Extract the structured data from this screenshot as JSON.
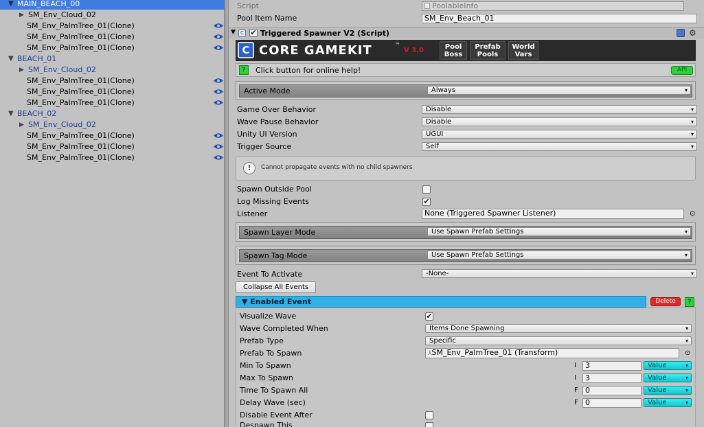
{
  "hierarchy": {
    "rows": [
      {
        "label": "MAIN_BEACH_00",
        "indent": 0,
        "expanded": true,
        "selected": true,
        "style": "normal",
        "eye": false
      },
      {
        "label": "SM_Env_Cloud_02",
        "indent": 1,
        "expanded": false,
        "selected": false,
        "style": "normal",
        "eye": false
      },
      {
        "label": "SM_Env_PalmTree_01(Clone)",
        "indent": 1,
        "expanded": null,
        "selected": false,
        "style": "normal",
        "eye": true
      },
      {
        "label": "SM_Env_PalmTree_01(Clone)",
        "indent": 1,
        "expanded": null,
        "selected": false,
        "style": "normal",
        "eye": true
      },
      {
        "label": "SM_Env_PalmTree_01(Clone)",
        "indent": 1,
        "expanded": null,
        "selected": false,
        "style": "normal",
        "eye": true
      },
      {
        "label": "BEACH_01",
        "indent": 0,
        "expanded": true,
        "selected": false,
        "style": "blue",
        "eye": false
      },
      {
        "label": "SM_Env_Cloud_02",
        "indent": 1,
        "expanded": false,
        "selected": false,
        "style": "blue",
        "eye": false
      },
      {
        "label": "SM_Env_PalmTree_01(Clone)",
        "indent": 1,
        "expanded": null,
        "selected": false,
        "style": "normal",
        "eye": true
      },
      {
        "label": "SM_Env_PalmTree_01(Clone)",
        "indent": 1,
        "expanded": null,
        "selected": false,
        "style": "normal",
        "eye": true
      },
      {
        "label": "SM_Env_PalmTree_01(Clone)",
        "indent": 1,
        "expanded": null,
        "selected": false,
        "style": "normal",
        "eye": true
      },
      {
        "label": "BEACH_02",
        "indent": 0,
        "expanded": true,
        "selected": false,
        "style": "blue",
        "eye": false
      },
      {
        "label": "SM_Env_Cloud_02",
        "indent": 1,
        "expanded": false,
        "selected": false,
        "style": "blue",
        "eye": false
      },
      {
        "label": "SM_Env_PalmTree_01(Clone)",
        "indent": 1,
        "expanded": null,
        "selected": false,
        "style": "normal",
        "eye": true
      },
      {
        "label": "SM_Env_PalmTree_01(Clone)",
        "indent": 1,
        "expanded": null,
        "selected": false,
        "style": "normal",
        "eye": true
      },
      {
        "label": "SM_Env_PalmTree_01(Clone)",
        "indent": 1,
        "expanded": null,
        "selected": false,
        "style": "normal",
        "eye": true
      }
    ]
  },
  "inspector": {
    "script_label": "Script",
    "script_value": "PoolableInfo",
    "pool_item_label": "Pool Item Name",
    "pool_item_value": "SM_Env_Beach_01",
    "component_title": "Triggered Spawner V2 (Script)",
    "logo_text": "CORE GAMEKIT",
    "logo_tm": "™",
    "logo_version": "V 3.0",
    "logo_buttons": [
      {
        "line1": "Pool",
        "line2": "Boss"
      },
      {
        "line1": "Prefab",
        "line2": "Pools"
      },
      {
        "line1": "World",
        "line2": "Vars"
      }
    ],
    "help_text": "Click button for online help!",
    "help_icon": "?",
    "api_label": "API",
    "active_mode_label": "Active Mode",
    "active_mode_value": "Always",
    "game_over_label": "Game Over Behavior",
    "game_over_value": "Disable",
    "wave_pause_label": "Wave Pause Behavior",
    "wave_pause_value": "Disable",
    "unity_ui_label": "Unity UI Version",
    "unity_ui_value": "UGUI",
    "trigger_source_label": "Trigger Source",
    "trigger_source_value": "Self",
    "note_text": "Cannot propagate events with no child spawners",
    "spawn_outside_label": "Spawn Outside Pool",
    "spawn_outside_checked": false,
    "log_missing_label": "Log Missing Events",
    "log_missing_checked": true,
    "listener_label": "Listener",
    "listener_value": "None (Triggered Spawner Listener)",
    "spawn_layer_label": "Spawn Layer Mode",
    "spawn_layer_value": "Use Spawn Prefab Settings",
    "spawn_tag_label": "Spawn Tag Mode",
    "spawn_tag_value": "Use Spawn Prefab Settings",
    "event_activate_label": "Event To Activate",
    "event_activate_value": "-None-",
    "collapse_button": "Collapse All Events",
    "event_header": "Enabled Event",
    "delete_button": "Delete",
    "event_help": "?",
    "visualize_label": "Visualize Wave",
    "visualize_checked": true,
    "wave_completed_label": "Wave Completed When",
    "wave_completed_value": "Items Done Spawning",
    "prefab_type_label": "Prefab Type",
    "prefab_type_value": "Specific",
    "prefab_spawn_label": "Prefab To Spawn",
    "prefab_spawn_value": "SM_Env_PalmTree_01 (Transform)",
    "min_spawn_label": "Min To Spawn",
    "min_spawn_type": "I",
    "min_spawn_value": "3",
    "min_spawn_mode": "Value",
    "max_spawn_label": "Max To Spawn",
    "max_spawn_type": "I",
    "max_spawn_value": "3",
    "max_spawn_mode": "Value",
    "time_spawn_label": "Time To Spawn All",
    "time_spawn_type": "F",
    "time_spawn_value": "0",
    "time_spawn_mode": "Value",
    "delay_label": "Delay Wave (sec)",
    "delay_type": "F",
    "delay_value": "0",
    "delay_mode": "Value",
    "disable_after_label": "Disable Event After",
    "disable_after_checked": false,
    "despawn_label": "Despawn This",
    "caret": "▾",
    "check_mark": "✔"
  }
}
